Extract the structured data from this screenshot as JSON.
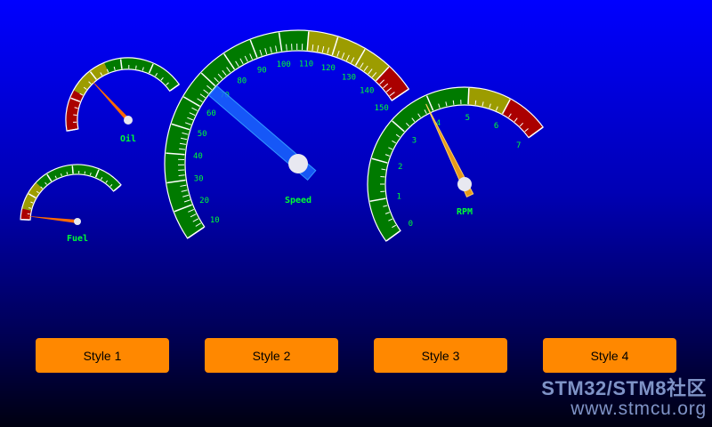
{
  "colors": {
    "green": "#007a00",
    "yellow": "#9c9c00",
    "red": "#aa0000",
    "tick": "#ffffff",
    "label": "#00ff33",
    "orange": "#ff6a00",
    "blue_needle": "#1a66ff",
    "amber_needle": "#e69a1a",
    "hub": "#e8e8f0",
    "button": "#ff8800"
  },
  "gauges": {
    "oil": {
      "label": "Oil",
      "min": 0,
      "max": 100,
      "value": 37,
      "zones": [
        {
          "from": 0,
          "to": 25,
          "color": "red"
        },
        {
          "from": 25,
          "to": 50,
          "color": "yellow"
        },
        {
          "from": 50,
          "to": 100,
          "color": "green"
        }
      ],
      "needle_color": "orange"
    },
    "fuel": {
      "label": "Fuel",
      "min": 0,
      "max": 100,
      "value": 3,
      "zones": [
        {
          "from": 0,
          "to": 8,
          "color": "red"
        },
        {
          "from": 8,
          "to": 30,
          "color": "yellow"
        },
        {
          "from": 30,
          "to": 100,
          "color": "green"
        }
      ],
      "needle_color": "orange"
    },
    "speed": {
      "label": "Speed",
      "min": 10,
      "max": 150,
      "value": 68,
      "tick_labels": [
        "10",
        "20",
        "30",
        "40",
        "50",
        "60",
        "70",
        "80",
        "90",
        "100",
        "110",
        "120",
        "130",
        "140",
        "150"
      ],
      "zones": [
        {
          "from": 10,
          "to": 110,
          "color": "green"
        },
        {
          "from": 110,
          "to": 140,
          "color": "yellow"
        },
        {
          "from": 140,
          "to": 150,
          "color": "red"
        }
      ],
      "needle_color": "blue_needle"
    },
    "rpm": {
      "label": "RPM",
      "min": 0,
      "max": 7,
      "value": 3.9,
      "tick_labels": [
        "0",
        "1",
        "2",
        "3",
        "4",
        "5",
        "6",
        "7"
      ],
      "zones": [
        {
          "from": 0,
          "to": 5,
          "color": "green"
        },
        {
          "from": 5,
          "to": 6,
          "color": "yellow"
        },
        {
          "from": 6,
          "to": 7,
          "color": "red"
        }
      ],
      "needle_color": "amber_needle"
    }
  },
  "buttons": {
    "style1": "Style 1",
    "style2": "Style 2",
    "style3": "Style 3",
    "style4": "Style 4"
  },
  "watermark": {
    "line1": "STM32/STM8社区",
    "line2": "www.stmcu.org"
  }
}
